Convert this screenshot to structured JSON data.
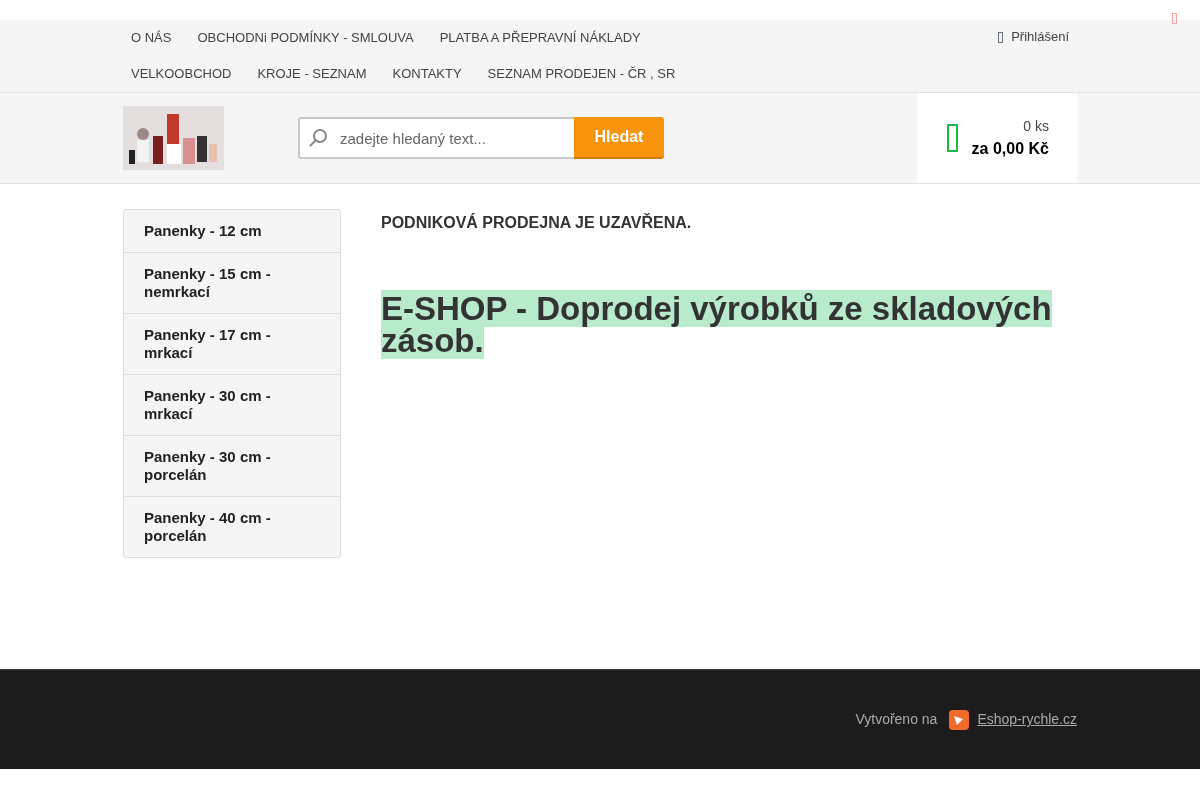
{
  "menu": [
    [
      {
        "label": "O NÁS"
      },
      {
        "label": "OBCHODNi PODMÍNKY - SMLOUVA"
      },
      {
        "label": "PLATBA A PŘEPRAVNÍ NÁKLADY"
      }
    ],
    [
      {
        "label": "VELKOOBCHOD"
      },
      {
        "label": "KROJE - SEZNAM"
      },
      {
        "label": "KONTAKTY"
      },
      {
        "label": "SEZNAM PRODEJEN - ČR , SR"
      }
    ]
  ],
  "login": {
    "label": "Přihlášení"
  },
  "search": {
    "placeholder": "zadejte hledaný text...",
    "button": "Hledat"
  },
  "cart": {
    "count": "0 ks",
    "total": "za 0,00 Kč"
  },
  "sidebar": {
    "items": [
      {
        "label": "Panenky - 12 cm"
      },
      {
        "label": "Panenky - 15 cm - nemrkací"
      },
      {
        "label": "Panenky - 17 cm - mrkací"
      },
      {
        "label": "Panenky - 30 cm - mrkací"
      },
      {
        "label": "Panenky - 30 cm - porcelán"
      },
      {
        "label": "Panenky - 40 cm - porcelán"
      }
    ]
  },
  "content": {
    "notice": "PODNIKOVÁ PRODEJNA JE UZAVŘENA.",
    "headline": "E-SHOP - Doprodej výrobků ze skladových zásob."
  },
  "footer": {
    "text": "Vytvořeno na",
    "link": "Eshop-rychle.cz"
  }
}
